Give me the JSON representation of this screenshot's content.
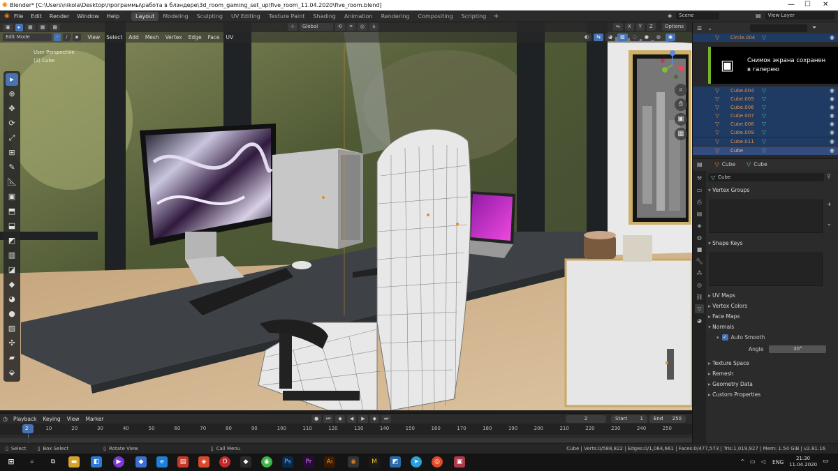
{
  "window": {
    "title": "Blender* [C:\\Users\\nikola\\Desktop\\программы\\работа в блэндере\\3d_room_gaming_set_up\\five_room_11.04.2020\\five_room.blend]"
  },
  "topbar": {
    "menus": [
      "File",
      "Edit",
      "Render",
      "Window",
      "Help"
    ],
    "workspaces": [
      "Layout",
      "Modeling",
      "Sculpting",
      "UV Editing",
      "Texture Paint",
      "Shading",
      "Animation",
      "Rendering",
      "Compositing",
      "Scripting"
    ],
    "active_workspace": "Layout",
    "scene": "Scene",
    "view_layer": "View Layer"
  },
  "viewport": {
    "mode": "Edit Mode",
    "menus": [
      "View",
      "Select",
      "Add",
      "Mesh",
      "Vertex",
      "Edge",
      "Face",
      "UV"
    ],
    "orientation": "Global",
    "options_label": "Options",
    "info_line1": "User Perspective",
    "info_line2": "(2) Cube",
    "tools": [
      "select-box",
      "cursor",
      "move",
      "rotate",
      "scale",
      "transform",
      "annotate",
      "measure",
      "add-cube",
      "extrude",
      "inset",
      "bevel",
      "loop-cut",
      "knife",
      "poly-build",
      "spin",
      "smooth",
      "edge-slide",
      "shrink-fatten",
      "shear",
      "rip"
    ]
  },
  "outliner": {
    "items": [
      {
        "name": "Circle.004"
      },
      {
        "name": "Cube.004"
      },
      {
        "name": "Cube.005"
      },
      {
        "name": "Cube.006"
      },
      {
        "name": "Cube.007"
      },
      {
        "name": "Cube.008"
      },
      {
        "name": "Cube.009"
      },
      {
        "name": "Cube.011"
      },
      {
        "name": "Cube"
      }
    ]
  },
  "notification": {
    "line1": "Снимок экрана сохранен",
    "line2": "в галерею"
  },
  "properties": {
    "object_name": "Cube",
    "mesh_name": "Cube",
    "data_field": "Cube",
    "sections": [
      "Vertex Groups",
      "Shape Keys",
      "UV Maps",
      "Vertex Colors",
      "Face Maps",
      "Normals",
      "Texture Space",
      "Remesh",
      "Geometry Data",
      "Custom Properties"
    ],
    "auto_smooth_label": "Auto Smooth",
    "angle_label": "Angle",
    "angle_value": "30°"
  },
  "timeline": {
    "menus": [
      "Playback",
      "Keying",
      "View",
      "Marker"
    ],
    "current_frame": "2",
    "start_label": "Start",
    "start_value": "1",
    "end_label": "End",
    "end_value": "250",
    "ruler": [
      "2",
      "10",
      "20",
      "30",
      "40",
      "50",
      "60",
      "70",
      "80",
      "90",
      "100",
      "110",
      "120",
      "130",
      "140",
      "150",
      "160",
      "170",
      "180",
      "190",
      "200",
      "210",
      "220",
      "230",
      "240",
      "250"
    ]
  },
  "statusbar": {
    "select": "Select",
    "box_select": "Box Select",
    "rotate_view": "Rotate View",
    "call_menu": "Call Menu",
    "stats": "Cube | Verts:0/588,822 | Edges:0/1,064,661 | Faces:0/477,573 | Tris:1,019,927 | Mem: 1.54 GiB | v2.81.16"
  },
  "taskbar": {
    "lang": "ENG",
    "time": "21:30",
    "date": "11.04.2020"
  },
  "colors": {
    "accent": "#4772b3",
    "object_orange": "#e2924a",
    "modifier_teal": "#4bb9a8",
    "notification_green": "#73b42a"
  }
}
